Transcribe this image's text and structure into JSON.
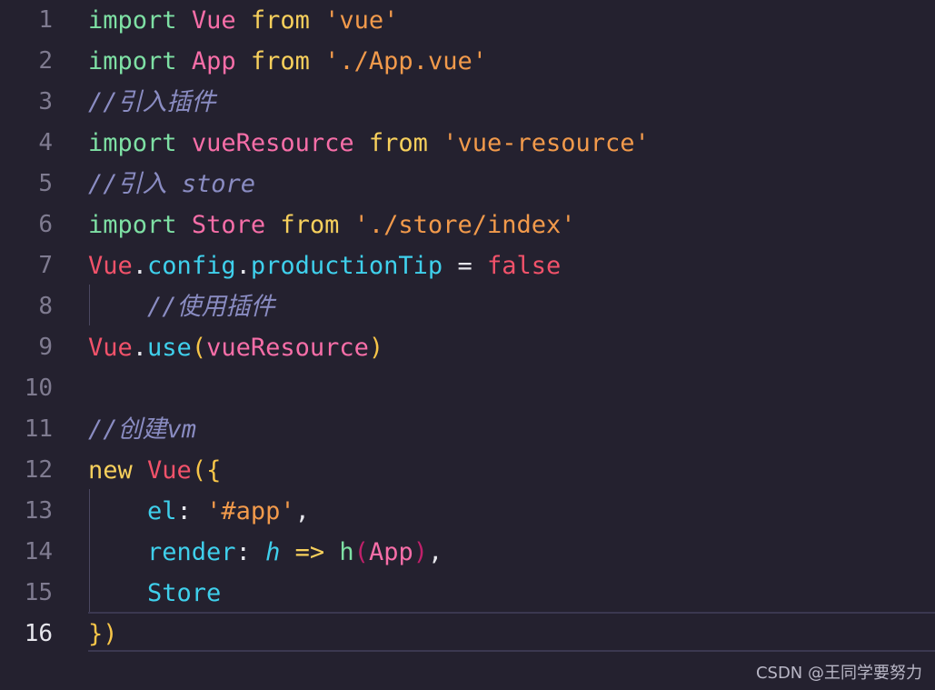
{
  "editor": {
    "lines": [
      {
        "no": "1",
        "tokens": [
          {
            "t": "import",
            "c": "kw"
          },
          {
            "t": " ",
            "c": "punc"
          },
          {
            "t": "Vue",
            "c": "cls"
          },
          {
            "t": " ",
            "c": "punc"
          },
          {
            "t": "from",
            "c": "from"
          },
          {
            "t": " ",
            "c": "punc"
          },
          {
            "t": "'vue'",
            "c": "str"
          }
        ]
      },
      {
        "no": "2",
        "tokens": [
          {
            "t": "import",
            "c": "kw"
          },
          {
            "t": " ",
            "c": "punc"
          },
          {
            "t": "App",
            "c": "cls"
          },
          {
            "t": " ",
            "c": "punc"
          },
          {
            "t": "from",
            "c": "from"
          },
          {
            "t": " ",
            "c": "punc"
          },
          {
            "t": "'./App.vue'",
            "c": "str"
          }
        ]
      },
      {
        "no": "3",
        "tokens": [
          {
            "t": "//引入插件",
            "c": "cmt"
          }
        ]
      },
      {
        "no": "4",
        "tokens": [
          {
            "t": "import",
            "c": "kw"
          },
          {
            "t": " ",
            "c": "punc"
          },
          {
            "t": "vueResource",
            "c": "cls"
          },
          {
            "t": " ",
            "c": "punc"
          },
          {
            "t": "from",
            "c": "from"
          },
          {
            "t": " ",
            "c": "punc"
          },
          {
            "t": "'vue-resource'",
            "c": "str"
          }
        ]
      },
      {
        "no": "5",
        "tokens": [
          {
            "t": "//引入 store",
            "c": "cmt"
          }
        ]
      },
      {
        "no": "6",
        "tokens": [
          {
            "t": "import",
            "c": "kw"
          },
          {
            "t": " ",
            "c": "punc"
          },
          {
            "t": "Store",
            "c": "cls"
          },
          {
            "t": " ",
            "c": "punc"
          },
          {
            "t": "from",
            "c": "from"
          },
          {
            "t": " ",
            "c": "punc"
          },
          {
            "t": "'./store/index'",
            "c": "str"
          }
        ]
      },
      {
        "no": "7",
        "tokens": [
          {
            "t": "Vue",
            "c": "red"
          },
          {
            "t": ".",
            "c": "punc"
          },
          {
            "t": "config",
            "c": "prop"
          },
          {
            "t": ".",
            "c": "punc"
          },
          {
            "t": "productionTip",
            "c": "prop"
          },
          {
            "t": " = ",
            "c": "punc"
          },
          {
            "t": "false",
            "c": "bool"
          }
        ]
      },
      {
        "no": "8",
        "tokens": [
          {
            "t": "    ",
            "c": "punc"
          },
          {
            "t": "//使用插件",
            "c": "cmt"
          }
        ]
      },
      {
        "no": "9",
        "tokens": [
          {
            "t": "Vue",
            "c": "red"
          },
          {
            "t": ".",
            "c": "punc"
          },
          {
            "t": "use",
            "c": "prop"
          },
          {
            "t": "(",
            "c": "brk1"
          },
          {
            "t": "vueResource",
            "c": "cls"
          },
          {
            "t": ")",
            "c": "brk1"
          }
        ]
      },
      {
        "no": "10",
        "tokens": []
      },
      {
        "no": "11",
        "tokens": [
          {
            "t": "//创建vm",
            "c": "cmt"
          }
        ]
      },
      {
        "no": "12",
        "tokens": [
          {
            "t": "new",
            "c": "from"
          },
          {
            "t": " ",
            "c": "punc"
          },
          {
            "t": "Vue",
            "c": "red"
          },
          {
            "t": "(",
            "c": "brk1"
          },
          {
            "t": "{",
            "c": "brk1"
          }
        ]
      },
      {
        "no": "13",
        "tokens": [
          {
            "t": "    ",
            "c": "punc"
          },
          {
            "t": "el",
            "c": "prop"
          },
          {
            "t": ": ",
            "c": "punc"
          },
          {
            "t": "'#app'",
            "c": "str"
          },
          {
            "t": ",",
            "c": "punc"
          }
        ]
      },
      {
        "no": "14",
        "tokens": [
          {
            "t": "    ",
            "c": "punc"
          },
          {
            "t": "render",
            "c": "prop"
          },
          {
            "t": ": ",
            "c": "punc"
          },
          {
            "t": "h",
            "c": "param"
          },
          {
            "t": " ",
            "c": "punc"
          },
          {
            "t": "=>",
            "c": "from"
          },
          {
            "t": " ",
            "c": "punc"
          },
          {
            "t": "h",
            "c": "kw"
          },
          {
            "t": "(",
            "c": "brk2"
          },
          {
            "t": "App",
            "c": "cls"
          },
          {
            "t": ")",
            "c": "brk2"
          },
          {
            "t": ",",
            "c": "punc"
          }
        ]
      },
      {
        "no": "15",
        "tokens": [
          {
            "t": "    ",
            "c": "punc"
          },
          {
            "t": "Store",
            "c": "prop"
          }
        ]
      },
      {
        "no": "16",
        "tokens": [
          {
            "t": "}",
            "c": "brk1"
          },
          {
            "t": ")",
            "c": "brk1"
          }
        ]
      }
    ],
    "active_line": "16"
  },
  "watermark": "CSDN @王同学要努力"
}
